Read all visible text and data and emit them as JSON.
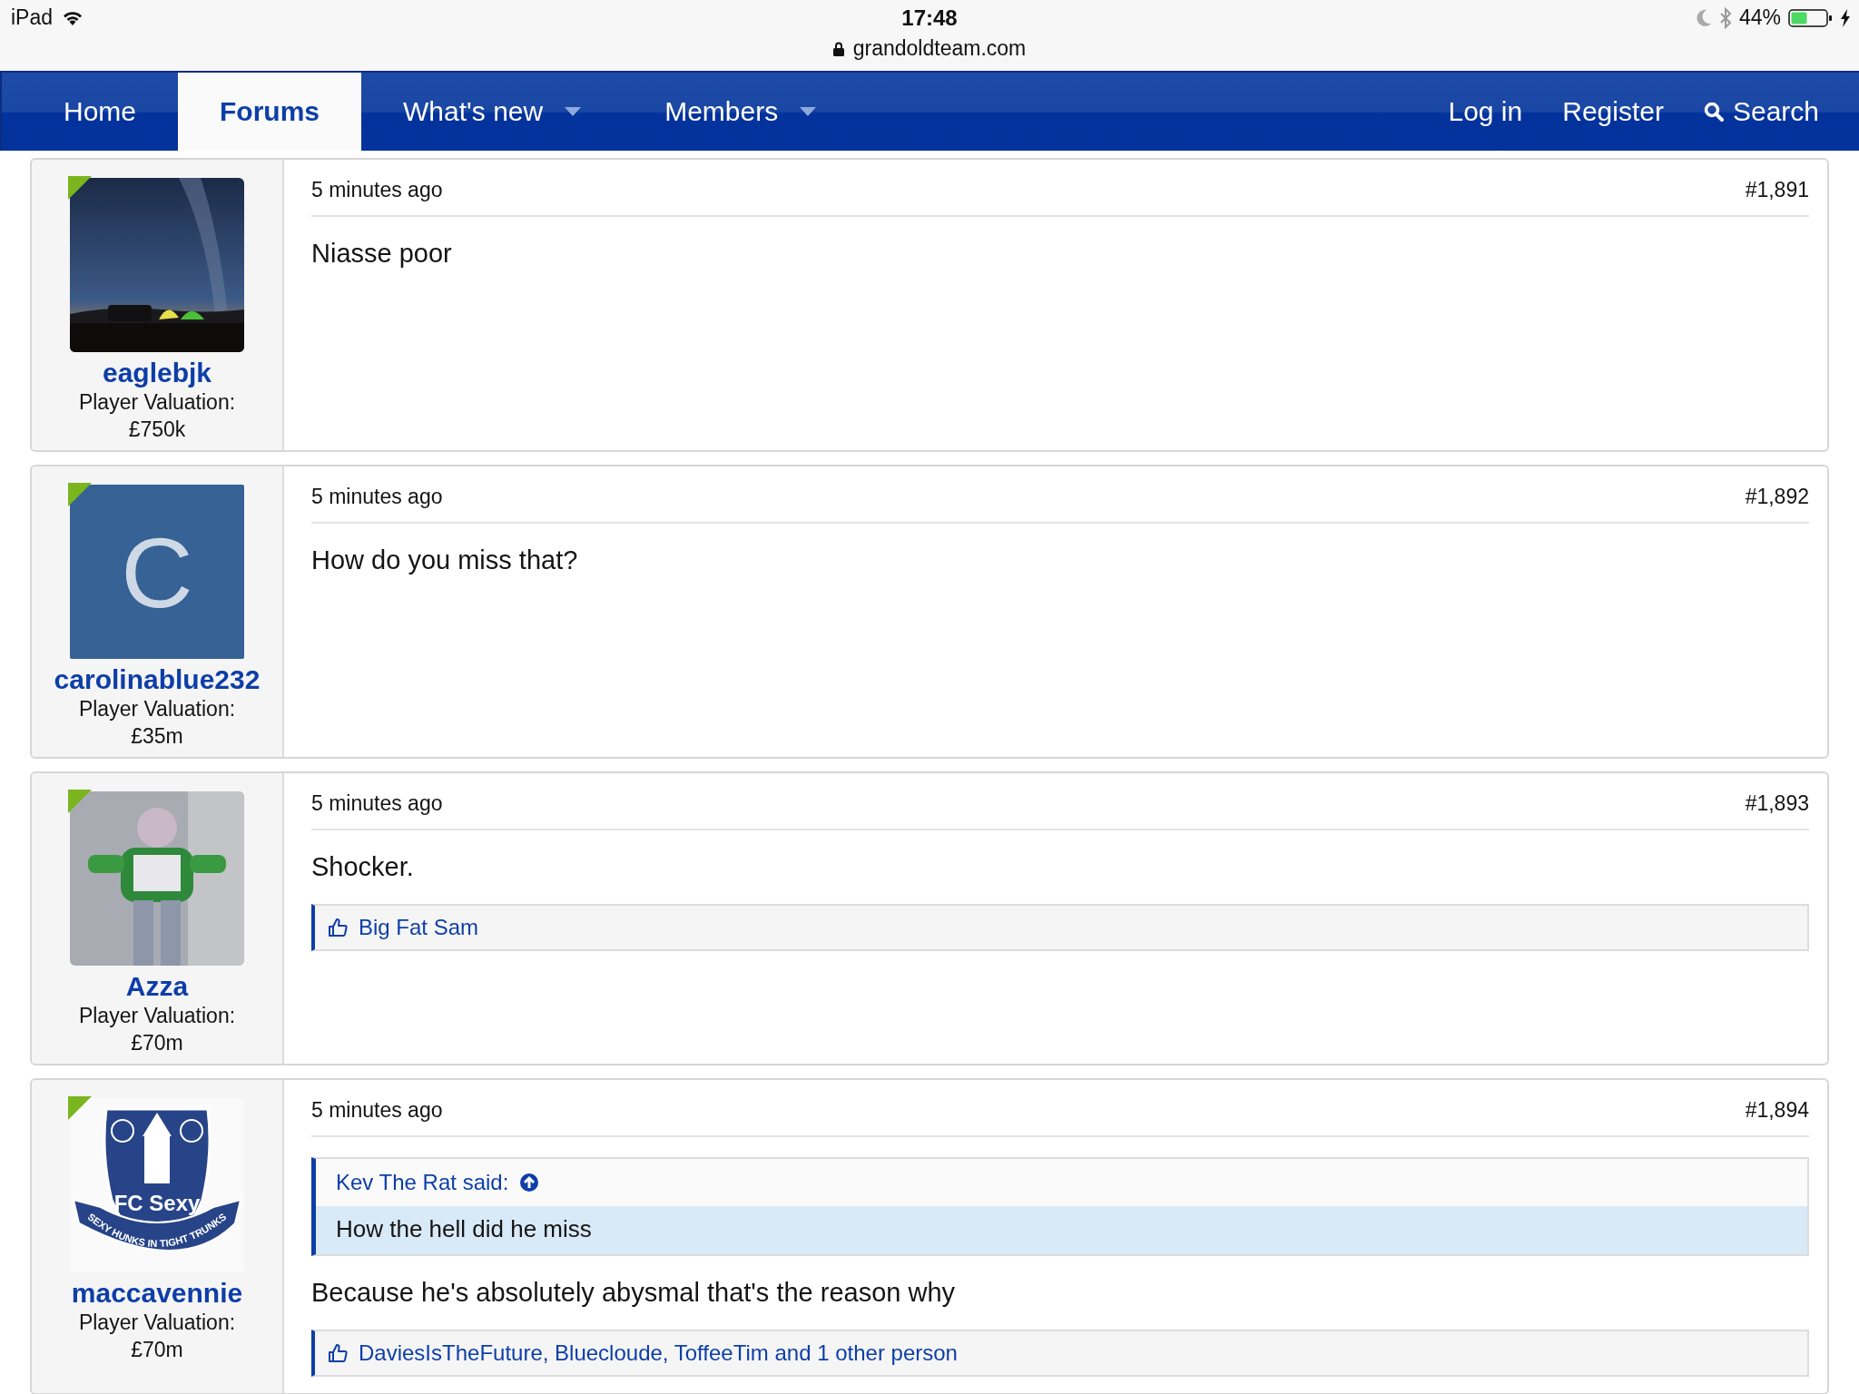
{
  "status_bar": {
    "device": "iPad",
    "time": "17:48",
    "url": "grandoldteam.com",
    "battery": "44%"
  },
  "nav": {
    "tabs": [
      {
        "label": "Home",
        "selected": false,
        "dropdown": false
      },
      {
        "label": "Forums",
        "selected": true,
        "dropdown": false
      },
      {
        "label": "What's new",
        "selected": false,
        "dropdown": true
      },
      {
        "label": "Members",
        "selected": false,
        "dropdown": true
      }
    ],
    "actions": [
      {
        "label": "Log in",
        "kind": "link"
      },
      {
        "label": "Register",
        "kind": "link"
      },
      {
        "label": "Search",
        "kind": "search"
      }
    ]
  },
  "posts": [
    {
      "user": "eaglebjk",
      "online": true,
      "avatar": {
        "kind": "picture"
      },
      "valuation_label": "Player Valuation:",
      "valuation": "£750k",
      "time": "5 minutes ago",
      "number": "#1,891",
      "content": [
        {
          "kind": "text",
          "text": "Niasse poor"
        }
      ]
    },
    {
      "user": "carolinablue232",
      "online": true,
      "avatar": {
        "kind": "letter",
        "letter": "C"
      },
      "valuation_label": "Player Valuation:",
      "valuation": "£35m",
      "time": "5 minutes ago",
      "number": "#1,892",
      "content": [
        {
          "kind": "text",
          "text": "How do you miss that?"
        }
      ]
    },
    {
      "user": "Azza",
      "online": true,
      "avatar": {
        "kind": "picture"
      },
      "valuation_label": "Player Valuation:",
      "valuation": "£70m",
      "time": "5 minutes ago",
      "number": "#1,893",
      "content": [
        {
          "kind": "text",
          "text": "Shocker."
        },
        {
          "kind": "likes",
          "text": "Big Fat Sam"
        }
      ]
    },
    {
      "user": "maccavennie",
      "online": true,
      "avatar": {
        "kind": "crest",
        "title": "FC Sexy",
        "motto": "SEXY HUNKS IN TIGHT TRUNKS"
      },
      "valuation_label": "Player Valuation:",
      "valuation": "£70m",
      "time": "5 minutes ago",
      "number": "#1,894",
      "content": [
        {
          "kind": "quote",
          "author": "Kev The Rat said:",
          "text": "How the hell did he miss"
        },
        {
          "kind": "text",
          "text": "Because he's absolutely abysmal that's the reason why"
        },
        {
          "kind": "likes",
          "text": "DaviesIsTheFuture, Bluecloude, ToffeeTim and 1 other person"
        }
      ]
    }
  ]
}
